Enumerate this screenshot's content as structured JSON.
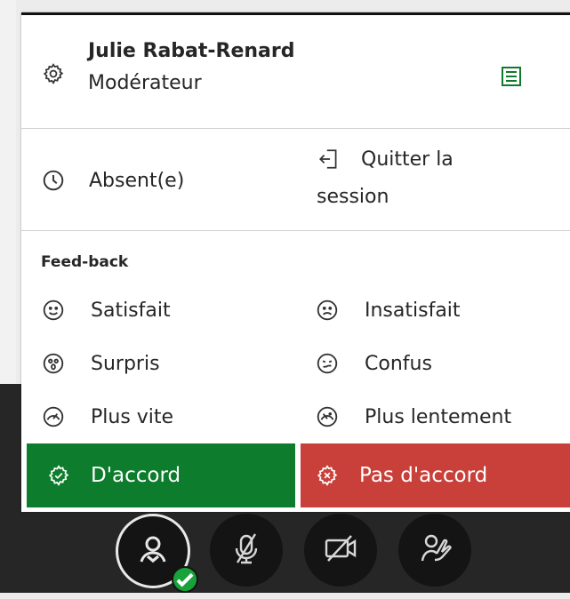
{
  "user": {
    "name": "Julie Rabat-Renard",
    "role": "Modérateur"
  },
  "status": {
    "away_label": "Absent(e)",
    "leave_line1": "Quitter la",
    "leave_line2": "session"
  },
  "feedback": {
    "section_title": "Feed-back",
    "items": [
      {
        "label": "Satisfait",
        "icon": "smile-icon"
      },
      {
        "label": "Insatisfait",
        "icon": "frown-icon"
      },
      {
        "label": "Surpris",
        "icon": "surprised-icon"
      },
      {
        "label": "Confus",
        "icon": "confused-icon"
      },
      {
        "label": "Plus vite",
        "icon": "speed-fast-icon"
      },
      {
        "label": "Plus lentement",
        "icon": "speed-slow-icon"
      }
    ],
    "agree_label": "D'accord",
    "disagree_label": "Pas d'accord"
  },
  "colors": {
    "agree": "#0d7c2c",
    "disagree": "#c9403a",
    "status_green": "#18a33a",
    "list_icon_green": "#0f7a2b",
    "control_bar": "#262626"
  },
  "controls": [
    {
      "name": "avatar-status-button",
      "icon": "user-icon"
    },
    {
      "name": "microphone-button",
      "icon": "microphone-off-icon"
    },
    {
      "name": "camera-button",
      "icon": "camera-off-icon"
    },
    {
      "name": "raise-hand-button",
      "icon": "hand-icon"
    }
  ]
}
